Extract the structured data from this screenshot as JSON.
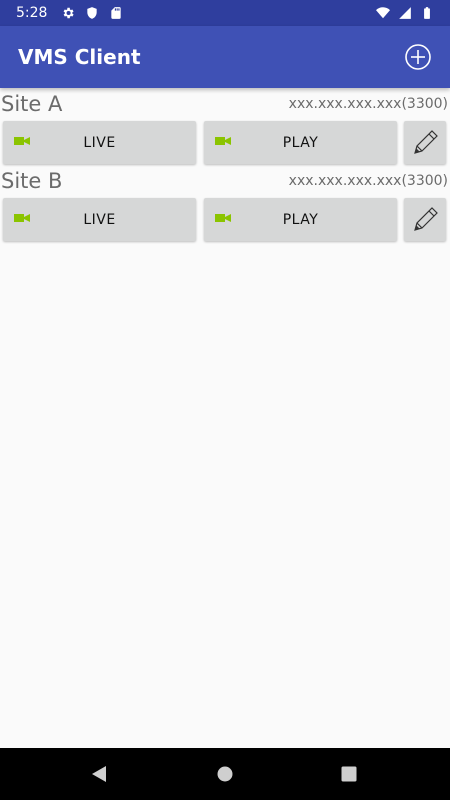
{
  "status_bar": {
    "time": "5:28",
    "icons": [
      "gear-icon",
      "shield-icon",
      "sd-card-icon",
      "wifi-icon",
      "cell-signal-icon",
      "battery-icon"
    ]
  },
  "app_bar": {
    "title": "VMS Client",
    "add_icon": "add-circle-icon"
  },
  "sites": [
    {
      "name": "Site A",
      "address": "xxx.xxx.xxx.xxx(3300)",
      "live_label": "LIVE",
      "play_label": "PLAY"
    },
    {
      "name": "Site B",
      "address": "xxx.xxx.xxx.xxx(3300)",
      "live_label": "LIVE",
      "play_label": "PLAY"
    }
  ],
  "colors": {
    "status_bar": "#2f3e9e",
    "app_bar": "#3f51b5",
    "camera_icon": "#8bc400",
    "button_bg": "#d6d7d7"
  },
  "nav_bar": {
    "icons": [
      "back-icon",
      "home-icon",
      "recents-icon"
    ]
  }
}
